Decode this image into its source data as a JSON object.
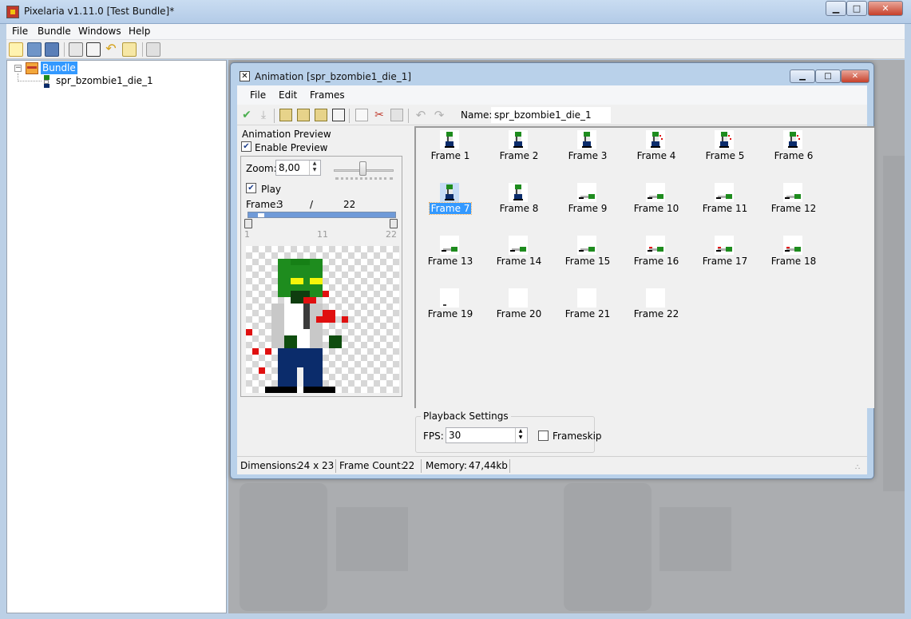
{
  "window": {
    "title": "Pixelaria v1.11.0 [Test Bundle]*"
  },
  "menu": [
    "File",
    "Bundle",
    "Windows",
    "Help"
  ],
  "toolbar": {
    "icons": [
      "new-bundle-icon",
      "open-bundle-icon",
      "save-bundle-icon",
      "bundle-settings-icon",
      "new-animation-icon",
      "undo-icon",
      "export-icon",
      "close-icon"
    ]
  },
  "tree": {
    "root_label": "Bundle",
    "children": [
      "spr_bzombie1_die_1"
    ]
  },
  "animation_window": {
    "title": "Animation [spr_bzombie1_die_1]",
    "menu": [
      "File",
      "Edit",
      "Frames"
    ],
    "name_label": "Name:",
    "name_value": "spr_bzombie1_die_1",
    "preview": {
      "title": "Animation Preview",
      "enable_label": "Enable Preview",
      "enable_checked": true,
      "zoom_label": "Zoom:",
      "zoom_value": "8,00",
      "play_label": "Play",
      "play_checked": true,
      "frame_label": "Frame:",
      "frame_current": "3",
      "frame_slash": "/",
      "frame_total": "22",
      "ticks": [
        "1",
        "11",
        "22"
      ]
    },
    "frames": [
      {
        "label": "Frame 1"
      },
      {
        "label": "Frame 2"
      },
      {
        "label": "Frame 3"
      },
      {
        "label": "Frame 4"
      },
      {
        "label": "Frame 5"
      },
      {
        "label": "Frame 6"
      },
      {
        "label": "Frame 7"
      },
      {
        "label": "Frame 8"
      },
      {
        "label": "Frame 9"
      },
      {
        "label": "Frame 10"
      },
      {
        "label": "Frame 11"
      },
      {
        "label": "Frame 12"
      },
      {
        "label": "Frame 13"
      },
      {
        "label": "Frame 14"
      },
      {
        "label": "Frame 15"
      },
      {
        "label": "Frame 16"
      },
      {
        "label": "Frame 17"
      },
      {
        "label": "Frame 18"
      },
      {
        "label": "Frame 19"
      },
      {
        "label": "Frame 20"
      },
      {
        "label": "Frame 21"
      },
      {
        "label": "Frame 22"
      }
    ],
    "selected_frame": "Frame 7",
    "playback": {
      "title": "Playback Settings",
      "fps_label": "FPS:",
      "fps_value": "30",
      "frameskip_label": "Frameskip",
      "frameskip_checked": false
    },
    "status": {
      "dimensions_label": "Dimensions:",
      "dimensions_value": "24 x 23",
      "frame_count_label": "Frame Count:",
      "frame_count_value": "22",
      "memory_label": "Memory:",
      "memory_value": "47,44kb"
    }
  },
  "colors": {
    "selection": "#3399ff",
    "zombie_skin": "#1e8c1e",
    "zombie_pants": "#0b2c6b",
    "blood": "#e01010"
  }
}
